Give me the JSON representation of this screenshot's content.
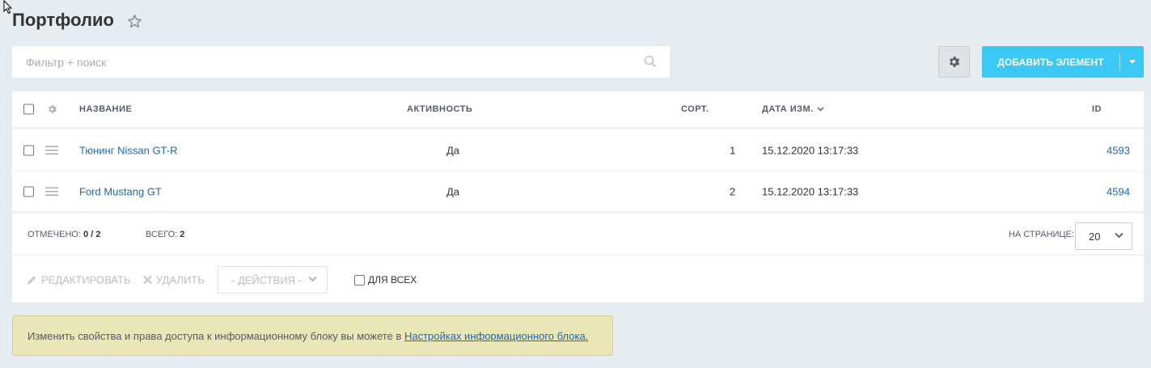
{
  "page": {
    "title": "Портфолио"
  },
  "filter": {
    "placeholder": "Фильтр + поиск"
  },
  "toolbar": {
    "add_label": "ДОБАВИТЬ ЭЛЕМЕНТ"
  },
  "grid": {
    "columns": {
      "name": "НАЗВАНИЕ",
      "active": "АКТИВНОСТЬ",
      "sort": "СОРТ.",
      "date": "ДАТА ИЗМ.",
      "id": "ID"
    },
    "rows": [
      {
        "name": "Тюнинг Nissan GT-R",
        "active": "Да",
        "sort": "1",
        "date": "15.12.2020 13:17:33",
        "id": "4593"
      },
      {
        "name": "Ford Mustang GT",
        "active": "Да",
        "sort": "2",
        "date": "15.12.2020 13:17:33",
        "id": "4594"
      }
    ]
  },
  "footer": {
    "selected_label": "ОТМЕЧЕНО:",
    "selected_value": "0 / 2",
    "total_label": "ВСЕГО:",
    "total_value": "2",
    "per_page_label": "НА СТРАНИЦЕ:",
    "per_page_value": "20",
    "edit_label": "РЕДАКТИРОВАТЬ",
    "delete_label": "УДАЛИТЬ",
    "actions_label": "- ДЕЙСТВИЯ -",
    "for_all_label": "ДЛЯ ВСЕХ"
  },
  "notice": {
    "text": "Изменить свойства и права доступа к информационному блоку вы можете в",
    "link": "Настройках информационного блока."
  },
  "colors": {
    "accent": "#3bc8f5",
    "link": "#2067b0",
    "notice_bg": "#e9e6b7",
    "page_bg": "#e6ecef"
  }
}
